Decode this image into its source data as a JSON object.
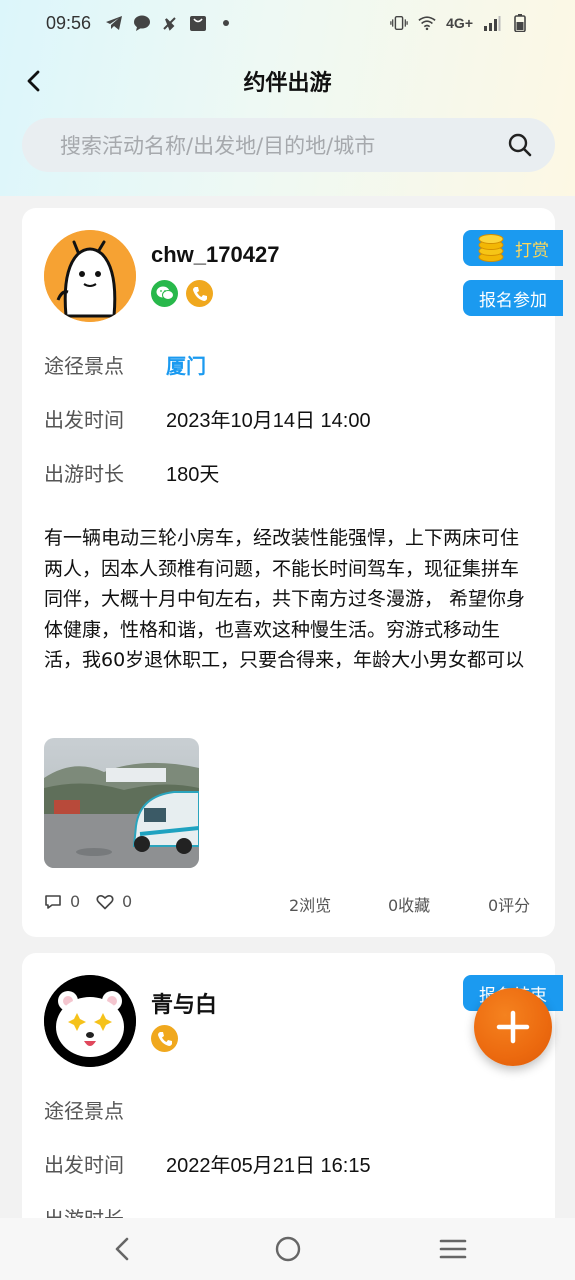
{
  "status_bar": {
    "time": "09:56",
    "network": "4G+"
  },
  "nav": {
    "title": "约伴出游"
  },
  "search": {
    "placeholder": "搜索活动名称/出发地/目的地/城市"
  },
  "posts": [
    {
      "username": "chw_170427",
      "reward_label": "打赏",
      "action_label": "报名参加",
      "route_label": "途径景点",
      "route_value": "厦门",
      "depart_label": "出发时间",
      "depart_value": "2023年10月14日 14:00",
      "duration_label": "出游时长",
      "duration_value": "180天",
      "description": "有一辆电动三轮小房车，经改装性能强悍，上下两床可住两人，因本人颈椎有问题，不能长时间驾车，现征集拼车同伴，大概十月中旬左右，共下南方过冬漫游， 希望你身体健康，性格和谐，也喜欢这种慢生活。穷游式移动生活，我60岁退休职工，只要合得来，年龄大小男女都可以",
      "comments": "0",
      "likes": "0",
      "views": "2浏览",
      "favorites": "0收藏",
      "ratings": "0评分"
    },
    {
      "username": "青与白",
      "action_label": "报名结束",
      "route_label": "途径景点",
      "route_value": "",
      "depart_label": "出发时间",
      "depart_value": "2022年05月21日 16:15",
      "duration_label": "出游时长"
    }
  ],
  "colors": {
    "accent": "#1b9af0",
    "fab": "#ec6a0f",
    "wechat": "#28b84b",
    "phone": "#f0a81e"
  }
}
